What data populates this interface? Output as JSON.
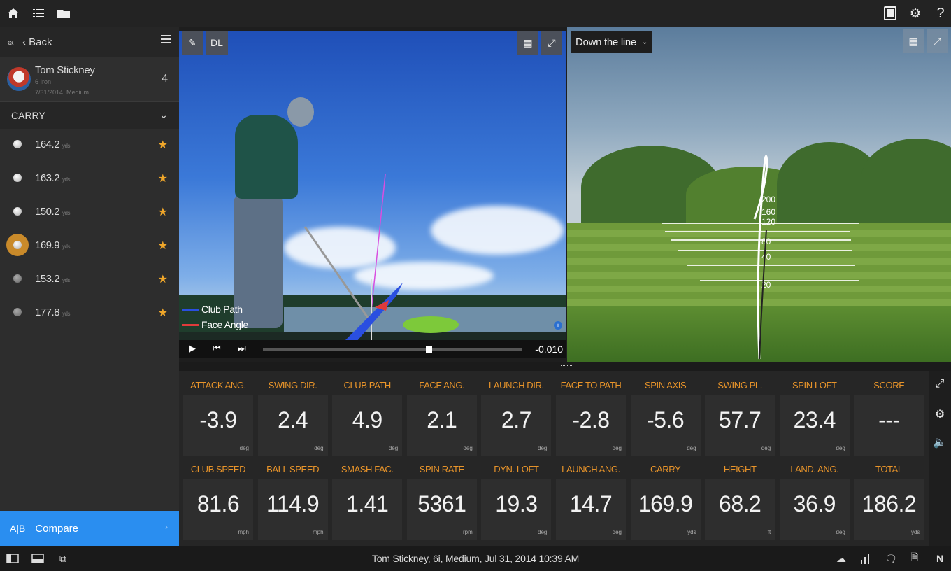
{
  "toolbar": {
    "left_icons": [
      "home-icon",
      "list-icon",
      "folder-icon"
    ],
    "right_icons": [
      "book-icon",
      "gear-icon",
      "help-icon"
    ],
    "help_label": "?"
  },
  "sidebar": {
    "back_label": "Back",
    "player": {
      "name": "Tom Stickney",
      "club": "6 Iron",
      "date": "7/31/2014, Medium",
      "count": "4"
    },
    "section_label": "CARRY",
    "unit": "yds",
    "shots": [
      {
        "value": "164.2",
        "starred": true,
        "selected": false,
        "dim": false
      },
      {
        "value": "163.2",
        "starred": true,
        "selected": false,
        "dim": false
      },
      {
        "value": "150.2",
        "starred": true,
        "selected": false,
        "dim": false
      },
      {
        "value": "169.9",
        "starred": true,
        "selected": true,
        "dim": false
      },
      {
        "value": "153.2",
        "starred": true,
        "selected": false,
        "dim": true
      },
      {
        "value": "177.8",
        "starred": true,
        "selected": false,
        "dim": true
      }
    ],
    "compare": {
      "ab_label": "A|B",
      "label": "Compare"
    }
  },
  "video": {
    "dl_label": "DL",
    "legend": [
      {
        "label": "Club Path",
        "color": "#2a4fe0"
      },
      {
        "label": "Face Angle",
        "color": "#e03b3b"
      }
    ],
    "time": "-0.010",
    "progress": 0.63
  },
  "view3d": {
    "view_select": "Down the line",
    "yard_labels": [
      "200",
      "160",
      "120",
      "80",
      "40",
      "20"
    ]
  },
  "metrics": {
    "row1": [
      {
        "label": "ATTACK ANG.",
        "value": "-3.9",
        "unit": "deg"
      },
      {
        "label": "SWING DIR.",
        "value": "2.4",
        "unit": "deg"
      },
      {
        "label": "CLUB PATH",
        "value": "4.9",
        "unit": "deg"
      },
      {
        "label": "FACE ANG.",
        "value": "2.1",
        "unit": "deg"
      },
      {
        "label": "LAUNCH DIR.",
        "value": "2.7",
        "unit": "deg"
      },
      {
        "label": "FACE TO PATH",
        "value": "-2.8",
        "unit": "deg"
      },
      {
        "label": "SPIN AXIS",
        "value": "-5.6",
        "unit": "deg"
      },
      {
        "label": "SWING PL.",
        "value": "57.7",
        "unit": "deg"
      },
      {
        "label": "SPIN LOFT",
        "value": "23.4",
        "unit": "deg"
      },
      {
        "label": "SCORE",
        "value": "---",
        "unit": ""
      }
    ],
    "row2": [
      {
        "label": "CLUB SPEED",
        "value": "81.6",
        "unit": "mph"
      },
      {
        "label": "BALL SPEED",
        "value": "114.9",
        "unit": "mph"
      },
      {
        "label": "SMASH FAC.",
        "value": "1.41",
        "unit": ""
      },
      {
        "label": "SPIN RATE",
        "value": "5361",
        "unit": "rpm"
      },
      {
        "label": "DYN. LOFT",
        "value": "19.3",
        "unit": "deg"
      },
      {
        "label": "LAUNCH ANG.",
        "value": "14.7",
        "unit": "deg"
      },
      {
        "label": "CARRY",
        "value": "169.9",
        "unit": "yds"
      },
      {
        "label": "HEIGHT",
        "value": "68.2",
        "unit": "ft"
      },
      {
        "label": "LAND. ANG.",
        "value": "36.9",
        "unit": "deg"
      },
      {
        "label": "TOTAL",
        "value": "186.2",
        "unit": "yds"
      }
    ]
  },
  "footer": {
    "status": "Tom Stickney, 6i, Medium, Jul 31, 2014 10:39 AM",
    "n_label": "N"
  },
  "colors": {
    "accent": "#e8942a",
    "compare": "#2a8ef0",
    "star": "#f0a72a"
  }
}
